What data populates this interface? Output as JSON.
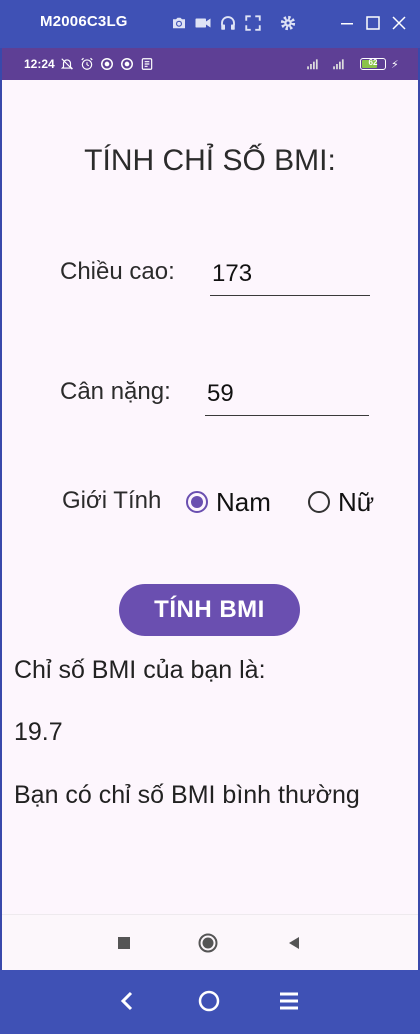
{
  "window": {
    "title": "M2006C3LG",
    "toolbar_icons": [
      "camera-icon",
      "video-icon",
      "headphones-icon",
      "fullscreen-icon",
      "settings-icon"
    ],
    "controls": [
      "minimize-icon",
      "maximize-icon",
      "close-icon"
    ]
  },
  "status_bar": {
    "time": "12:24",
    "battery_level": "62",
    "battery_fraction": 0.62,
    "icons": [
      "notifications-off-icon",
      "alarm-icon",
      "app-icon",
      "app-icon",
      "note-icon",
      "signal-icon",
      "signal-icon",
      "battery-icon",
      "charging-icon"
    ]
  },
  "app": {
    "title": "TÍNH CHỈ SỐ BMI:",
    "height_label": "Chiều cao:",
    "height_value": "173",
    "weight_label": "Cân nặng:",
    "weight_value": "59",
    "gender_label": "Giới Tính",
    "gender_options": [
      "Nam",
      "Nữ"
    ],
    "gender_selected": "Nam",
    "calc_button": "TÍNH BMI",
    "result_label": "Chỉ số BMI của bạn là:",
    "result_value": "19.7",
    "result_message": "Bạn có chỉ số BMI bình thường"
  },
  "colors": {
    "accent": "#6a4fb0",
    "status_bar": "#5e3f95",
    "emulator_bar": "#3f51b5",
    "background": "#fdf6fd"
  }
}
